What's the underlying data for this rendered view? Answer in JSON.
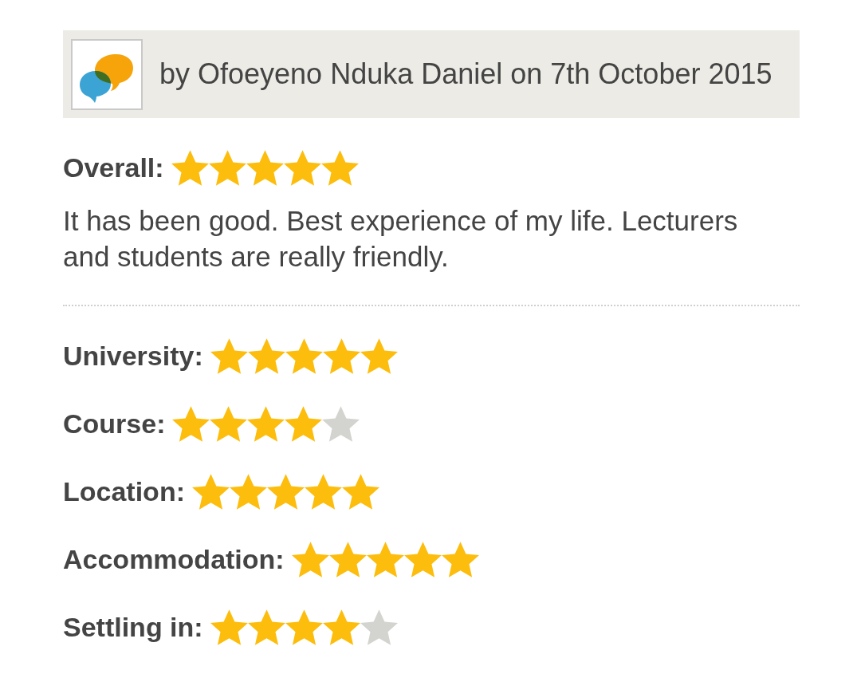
{
  "review": {
    "author_line": "by Ofoeyeno Nduka Daniel on 7th October 2015",
    "overall": {
      "label": "Overall:",
      "stars": 5
    },
    "comment": "It has been good. Best experience of my life. Lecturers and students are really friendly.",
    "ratings": [
      {
        "label": "University:",
        "stars": 5
      },
      {
        "label": "Course:",
        "stars": 4
      },
      {
        "label": "Location:",
        "stars": 5
      },
      {
        "label": "Accommodation:",
        "stars": 5
      },
      {
        "label": "Settling in:",
        "stars": 4
      }
    ]
  }
}
